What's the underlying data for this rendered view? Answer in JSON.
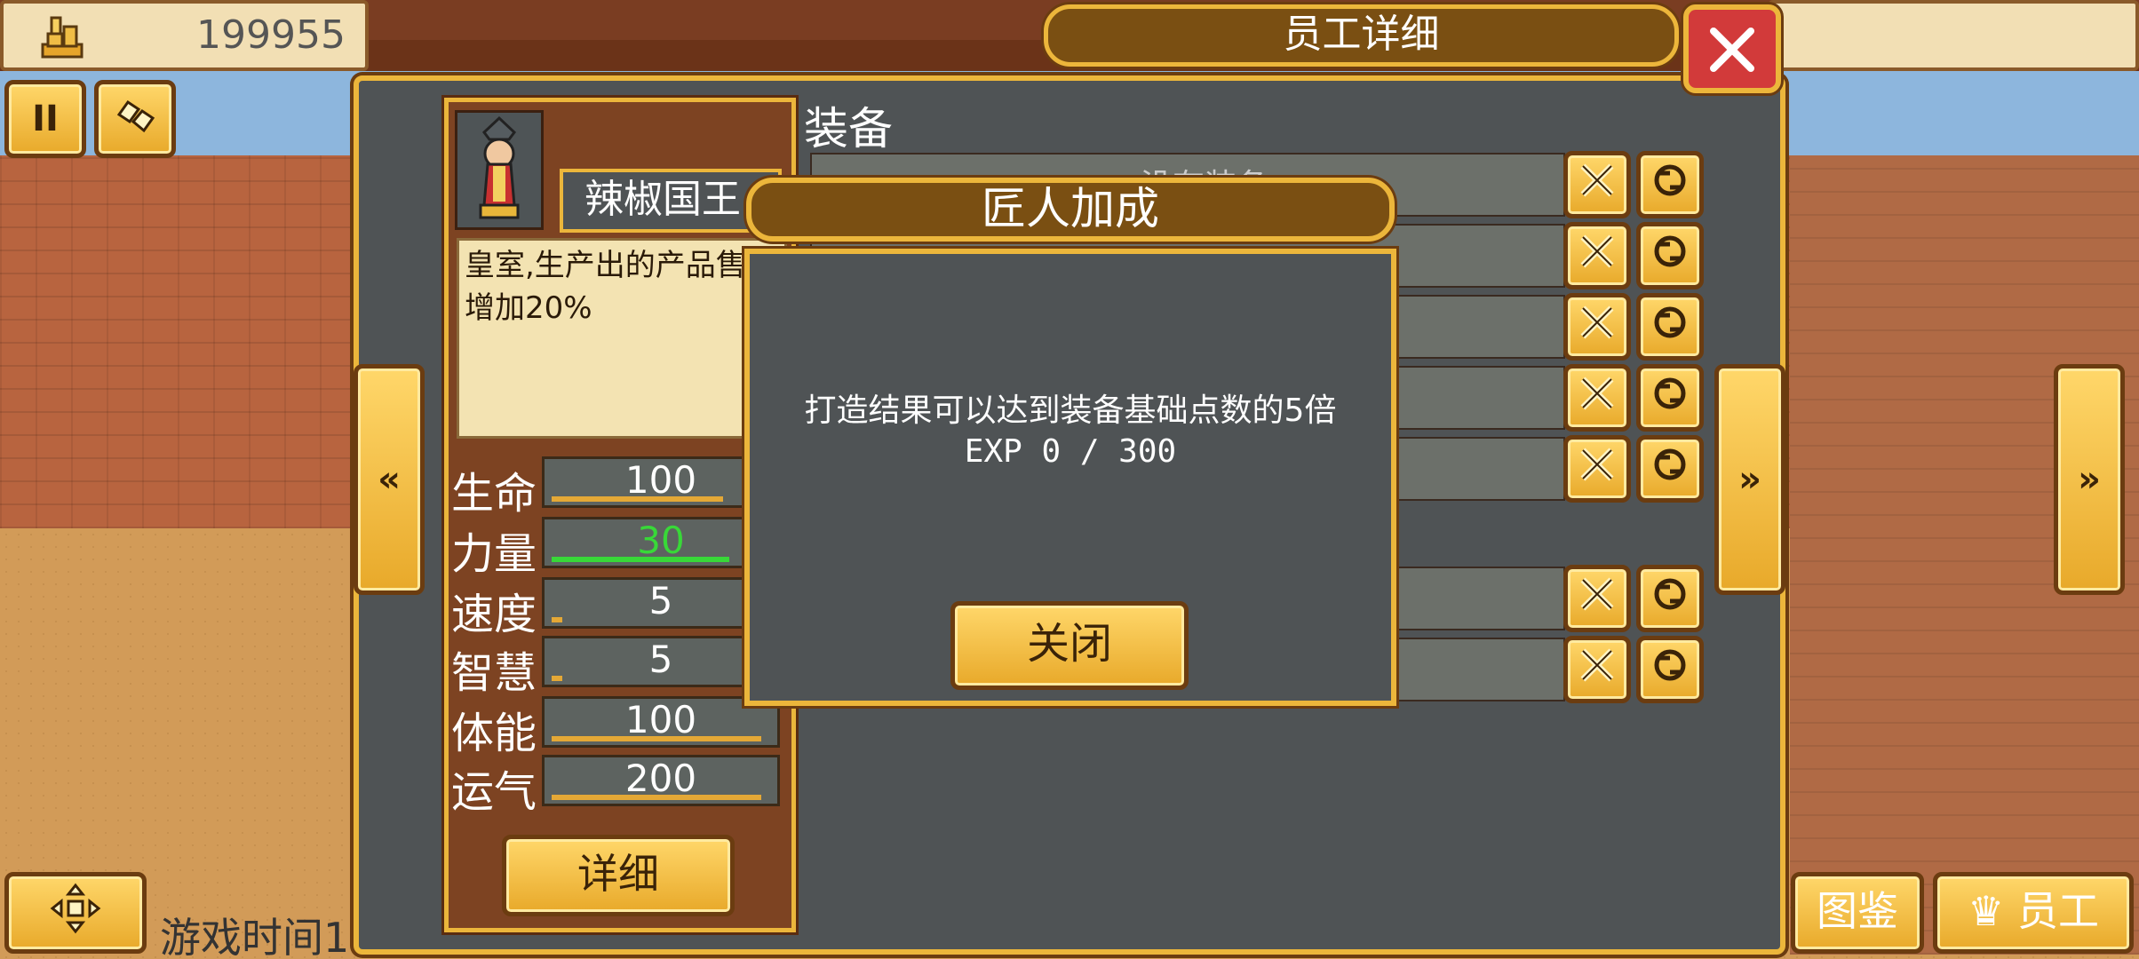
{
  "hud": {
    "money_value": "199955",
    "money_icon": "gold-stack-icon",
    "game_time_label": "游戏时间1"
  },
  "panel": {
    "title": "员工详细",
    "employee_name": "辣椒国王",
    "description": "皇室,生产出的产品售价增加20%",
    "detail_button": "详细",
    "equipment_label": "装备",
    "equipment_slot_hint": "没有装备",
    "stats": [
      {
        "label": "生命",
        "value": "100",
        "color": "#ffffff",
        "plus": "",
        "fill": 0.78
      },
      {
        "label": "力量",
        "value": "30",
        "color": "#38d838",
        "plus": "",
        "fill": 0.0
      },
      {
        "label": "速度",
        "value": "5",
        "color": "#ffffff",
        "plus": "+",
        "fill": 0.05
      },
      {
        "label": "智慧",
        "value": "5",
        "color": "#ffffff",
        "plus": "",
        "fill": 0.05
      },
      {
        "label": "体能",
        "value": "100",
        "color": "#ffffff",
        "plus": "",
        "fill": 0.95
      },
      {
        "label": "运气",
        "value": "200",
        "color": "#ffffff",
        "plus": "",
        "fill": 0.95
      }
    ]
  },
  "modal": {
    "title": "匠人加成",
    "line1": "打造结果可以达到装备基础点数的5倍",
    "line2": "EXP 0 / 300",
    "close_button": "关闭"
  },
  "bottom_bar": {
    "catalog_label": "图鉴",
    "staff_label": "员工"
  },
  "colors": {
    "gold": "#ecb63b",
    "panel_gray": "#4f5355",
    "close_red": "#d23a3a",
    "strength_green": "#38d838"
  }
}
